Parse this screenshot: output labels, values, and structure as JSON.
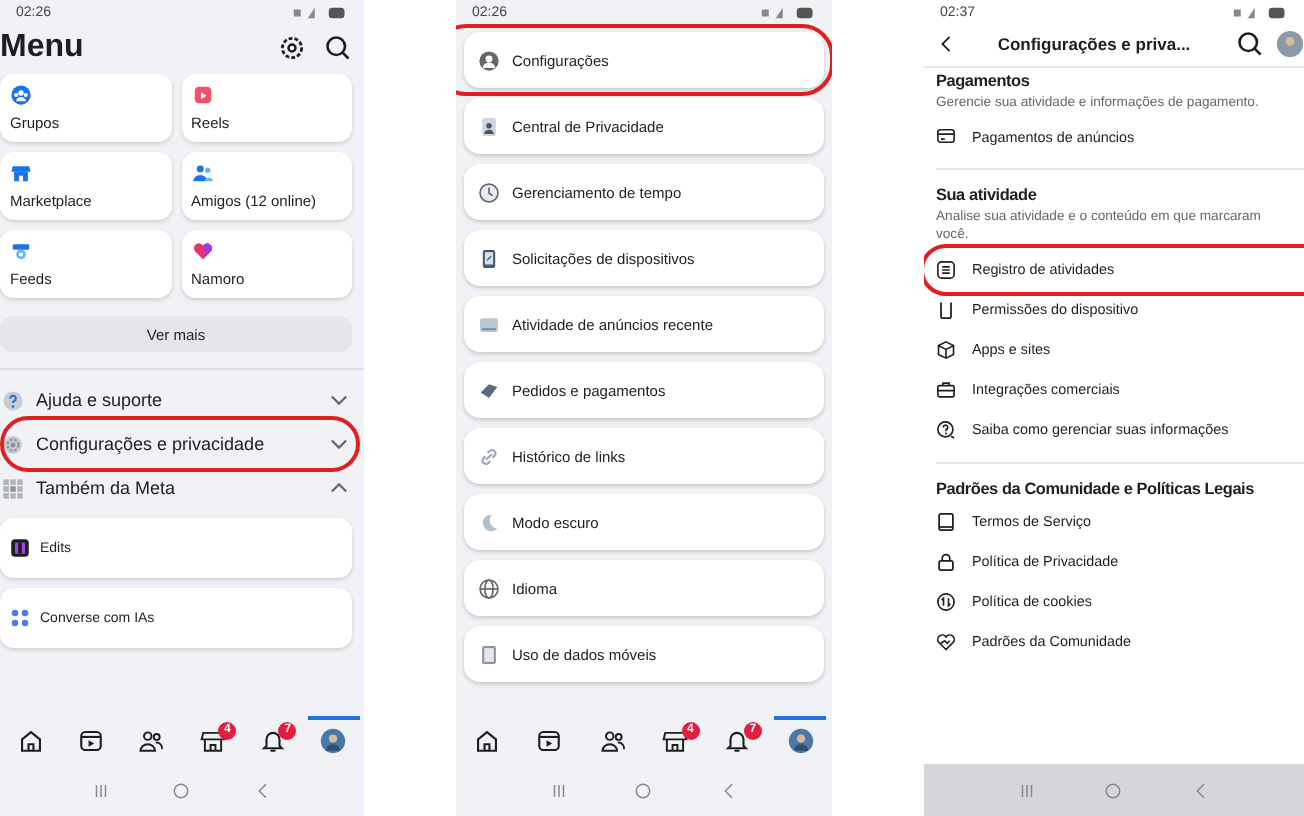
{
  "menu_screen": {
    "status_time": "02:26",
    "title": "Menu",
    "shortcuts": [
      {
        "label": "Grupos"
      },
      {
        "label": "Reels"
      },
      {
        "label": "Marketplace"
      },
      {
        "label": "Amigos (12 online)"
      },
      {
        "label": "Feeds"
      },
      {
        "label": "Namoro"
      }
    ],
    "see_more": "Ver mais",
    "sections": [
      {
        "label": "Ajuda e suporte",
        "expanded": false,
        "highlighted": false
      },
      {
        "label": "Configurações e privacidade",
        "expanded": false,
        "highlighted": true
      },
      {
        "label": "Também da Meta",
        "expanded": true,
        "highlighted": false
      }
    ],
    "meta_apps": [
      {
        "label": "Edits"
      },
      {
        "label": "Converse com IAs"
      }
    ],
    "nav_bar": [
      {
        "selected": false
      },
      {
        "selected": false
      },
      {
        "selected": false
      },
      {
        "selected": false,
        "badge": "4"
      },
      {
        "selected": false,
        "badge": "7"
      },
      {
        "selected": true
      }
    ]
  },
  "settings_list_screen": {
    "status_time": "02:26",
    "items": [
      {
        "label": "Configurações",
        "highlighted": true
      },
      {
        "label": "Central de Privacidade",
        "highlighted": false
      },
      {
        "label": "Gerenciamento de tempo",
        "highlighted": false
      },
      {
        "label": "Solicitações de dispositivos",
        "highlighted": false
      },
      {
        "label": "Atividade de anúncios recente",
        "highlighted": false
      },
      {
        "label": "Pedidos e pagamentos",
        "highlighted": false
      },
      {
        "label": "Histórico de links",
        "highlighted": false
      },
      {
        "label": "Modo escuro",
        "highlighted": false
      },
      {
        "label": "Idioma",
        "highlighted": false
      },
      {
        "label": "Uso de dados móveis",
        "highlighted": false
      }
    ],
    "nav_bar": [
      {
        "selected": false
      },
      {
        "selected": false
      },
      {
        "selected": false
      },
      {
        "selected": false,
        "badge": "4"
      },
      {
        "selected": false,
        "badge": "7"
      },
      {
        "selected": true
      }
    ]
  },
  "settings_screen": {
    "status_time": "02:37",
    "title": "Configurações e priva...",
    "sections": [
      {
        "heading": "Pagamentos",
        "description": "Gerencie sua atividade e informações de pagamento.",
        "items": [
          {
            "label": "Pagamentos de anúncios",
            "highlighted": false
          }
        ]
      },
      {
        "heading": "Sua atividade",
        "description": "Analise sua atividade e o conteúdo em que marcaram você.",
        "items": [
          {
            "label": "Registro de atividades",
            "highlighted": true
          },
          {
            "label": "Permissões do dispositivo",
            "highlighted": false
          },
          {
            "label": "Apps e sites",
            "highlighted": false
          },
          {
            "label": "Integrações comerciais",
            "highlighted": false
          },
          {
            "label": "Saiba como gerenciar suas informações",
            "highlighted": false
          }
        ]
      },
      {
        "heading": "Padrões da Comunidade e Políticas Legais",
        "items": [
          {
            "label": "Termos de Serviço",
            "highlighted": false
          },
          {
            "label": "Política de Privacidade",
            "highlighted": false
          },
          {
            "label": "Política de cookies",
            "highlighted": false
          },
          {
            "label": "Padrões da Comunidade",
            "highlighted": false
          }
        ]
      }
    ]
  }
}
